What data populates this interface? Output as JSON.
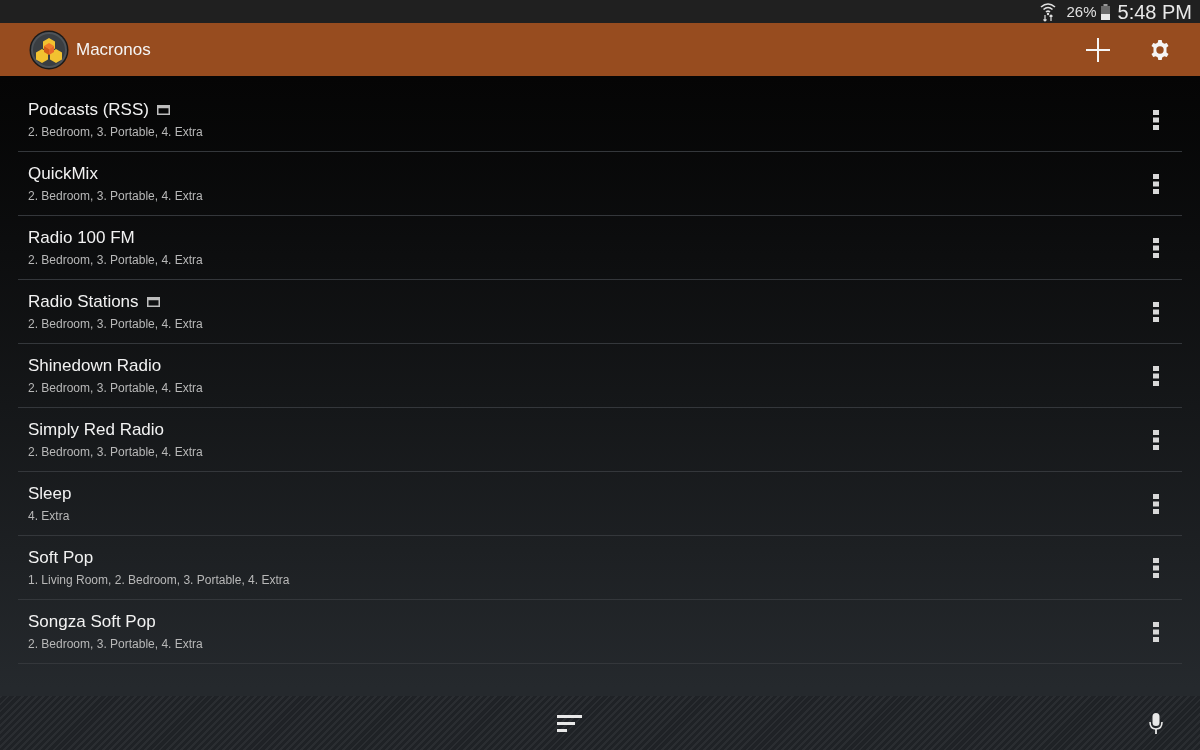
{
  "status_bar": {
    "battery": "26%",
    "time": "5:48 PM"
  },
  "app_bar": {
    "title": "Macronos"
  },
  "rows": [
    {
      "title": "Podcasts (RSS)",
      "folder": true,
      "subtitle": "2. Bedroom, 3. Portable, 4. Extra"
    },
    {
      "title": "QuickMix",
      "folder": false,
      "subtitle": "2. Bedroom, 3. Portable, 4. Extra"
    },
    {
      "title": "Radio 100 FM",
      "folder": false,
      "subtitle": "2. Bedroom, 3. Portable, 4. Extra"
    },
    {
      "title": "Radio Stations",
      "folder": true,
      "subtitle": "2. Bedroom, 3. Portable, 4. Extra"
    },
    {
      "title": "Shinedown Radio",
      "folder": false,
      "subtitle": "2. Bedroom, 3. Portable, 4. Extra"
    },
    {
      "title": "Simply Red Radio",
      "folder": false,
      "subtitle": "2. Bedroom, 3. Portable, 4. Extra"
    },
    {
      "title": "Sleep",
      "folder": false,
      "subtitle": "4. Extra"
    },
    {
      "title": "Soft Pop",
      "folder": false,
      "subtitle": "1. Living Room, 2. Bedroom, 3. Portable, 4. Extra"
    },
    {
      "title": "Songza Soft Pop",
      "folder": false,
      "subtitle": "2. Bedroom, 3. Portable, 4. Extra"
    }
  ]
}
